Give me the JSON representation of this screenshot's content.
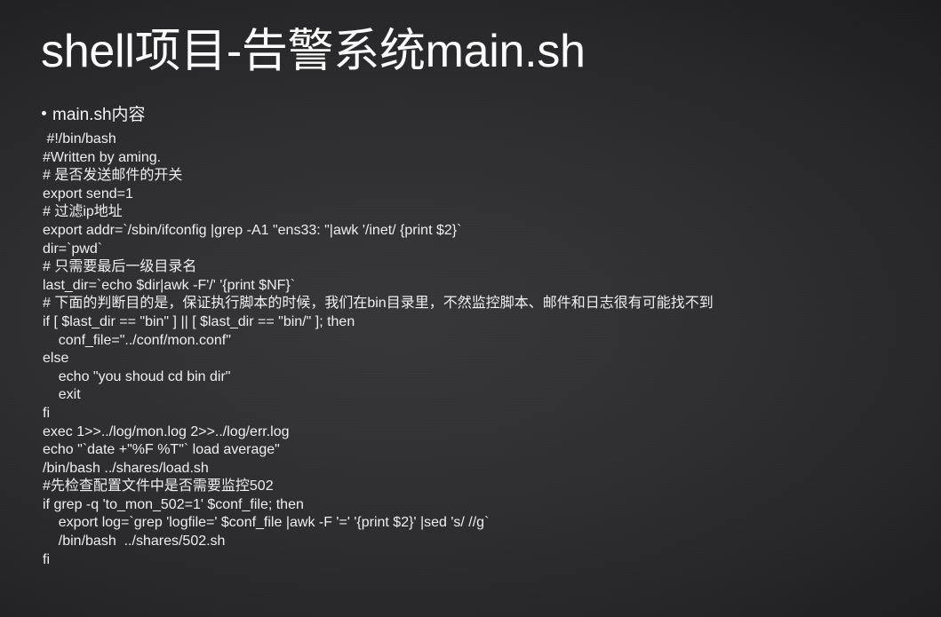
{
  "slide": {
    "title": "shell项目-告警系统main.sh",
    "background_color": "#2c2c2e",
    "text_color": "#f0f0f0",
    "bullet": {
      "marker": "bullet-dot",
      "label": "main.sh内容"
    },
    "code_lines": [
      " #!/bin/bash",
      "#Written by aming.",
      "# 是否发送邮件的开关",
      "export send=1",
      "# 过滤ip地址",
      "export addr=`/sbin/ifconfig |grep -A1 \"ens33: \"|awk '/inet/ {print $2}`",
      "dir=`pwd`",
      "# 只需要最后一级目录名",
      "last_dir=`echo $dir|awk -F'/' '{print $NF}`",
      "# 下面的判断目的是，保证执行脚本的时候，我们在bin目录里，不然监控脚本、邮件和日志很有可能找不到",
      "if [ $last_dir == \"bin\" ] || [ $last_dir == \"bin/\" ]; then",
      "    conf_file=\"../conf/mon.conf\"",
      "else",
      "    echo \"you shoud cd bin dir\"",
      "    exit",
      "fi",
      "exec 1>>../log/mon.log 2>>../log/err.log",
      "echo \"`date +\"%F %T\"` load average\"",
      "/bin/bash ../shares/load.sh",
      "#先检查配置文件中是否需要监控502",
      "if grep -q 'to_mon_502=1' $conf_file; then",
      "    export log=`grep 'logfile=' $conf_file |awk -F '=' '{print $2}' |sed 's/ //g`",
      "    /bin/bash  ../shares/502.sh",
      "fi"
    ]
  }
}
